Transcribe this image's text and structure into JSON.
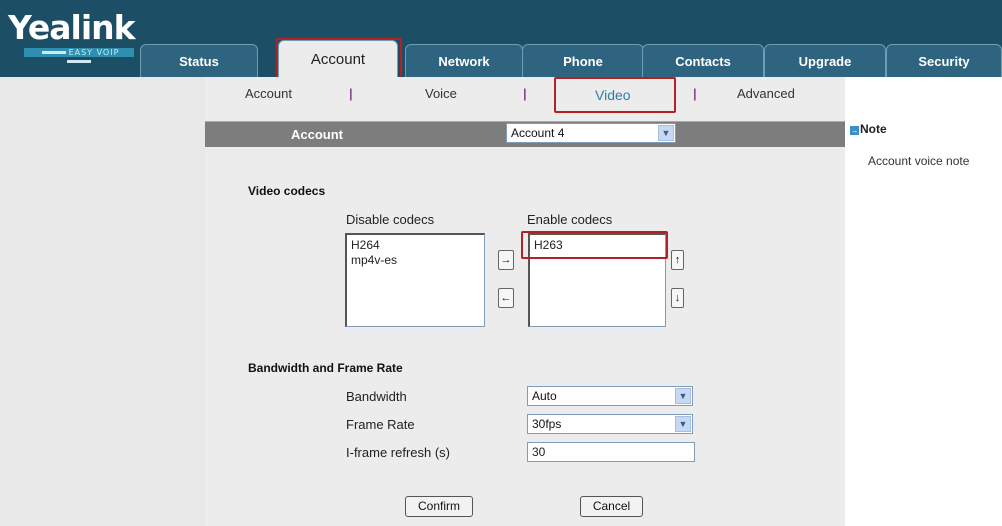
{
  "brand": {
    "name": "Yealink",
    "tagline": "EASY VOIP"
  },
  "tabs": [
    {
      "label": "Status"
    },
    {
      "label": "Account"
    },
    {
      "label": "Network"
    },
    {
      "label": "Phone"
    },
    {
      "label": "Contacts"
    },
    {
      "label": "Upgrade"
    },
    {
      "label": "Security"
    }
  ],
  "active_tab": "Account",
  "subnav": {
    "items": [
      {
        "label": "Account"
      },
      {
        "label": "Voice"
      },
      {
        "label": "Video"
      },
      {
        "label": "Advanced"
      }
    ],
    "separator": "|",
    "active": "Video"
  },
  "account_bar": {
    "label": "Account",
    "selected": "Account 4"
  },
  "video_codecs": {
    "title": "Video codecs",
    "disable_label": "Disable codecs",
    "enable_label": "Enable codecs",
    "disabled": [
      "H264",
      "mp4v-es"
    ],
    "enabled": [
      "H263"
    ],
    "move_right": "→",
    "move_left": "←",
    "move_up": "↑",
    "move_down": "↓"
  },
  "bandwidth": {
    "title": "Bandwidth and Frame Rate",
    "bandwidth_label": "Bandwidth",
    "bandwidth_value": "Auto",
    "framerate_label": "Frame Rate",
    "framerate_value": "30fps",
    "iframe_label": "I-frame refresh (s)",
    "iframe_value": "30"
  },
  "buttons": {
    "confirm": "Confirm",
    "cancel": "Cancel"
  },
  "note": {
    "title": "Note",
    "text": "Account voice note"
  },
  "colors": {
    "header": "#1c4f66",
    "tab": "#2e6480",
    "highlight": "#b22222",
    "content_bg": "#ececec",
    "account_bar": "#7d7d7d"
  },
  "icons": {
    "dropdown": "chevron-down-icon",
    "note": "note-icon"
  }
}
